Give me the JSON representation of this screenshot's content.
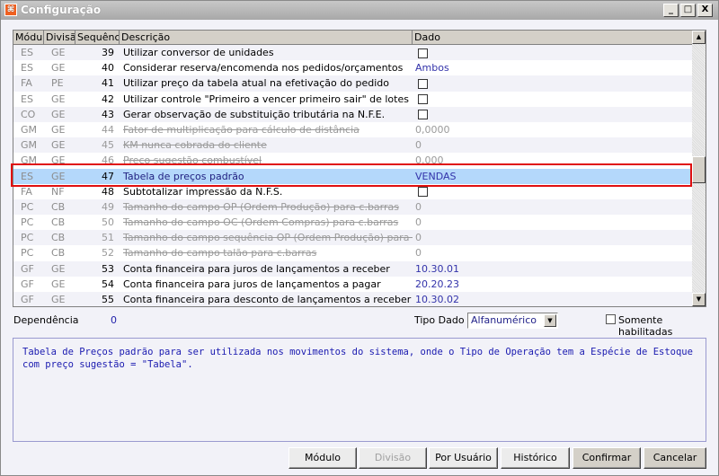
{
  "window": {
    "title": "Configuração",
    "minimize": "_",
    "maximize": "□",
    "close": "X"
  },
  "grid": {
    "headers": [
      "Módulo",
      "Divisão",
      "Sequência",
      "Descrição",
      "Dado"
    ],
    "rows": [
      {
        "modulo": "ES",
        "divisao": "GE",
        "seq": "39",
        "desc": "Utilizar conversor de unidades",
        "dado": "",
        "checkbox": true,
        "disabled": false
      },
      {
        "modulo": "ES",
        "divisao": "GE",
        "seq": "40",
        "desc": "Considerar reserva/encomenda nos pedidos/orçamentos",
        "dado": "Ambos",
        "checkbox": false,
        "disabled": false
      },
      {
        "modulo": "FA",
        "divisao": "PE",
        "seq": "41",
        "desc": "Utilizar preço da tabela atual na efetivação do pedido",
        "dado": "",
        "checkbox": true,
        "disabled": false
      },
      {
        "modulo": "ES",
        "divisao": "GE",
        "seq": "42",
        "desc": "Utilizar controle \"Primeiro a vencer primeiro sair\" de lotes",
        "dado": "",
        "checkbox": true,
        "disabled": false
      },
      {
        "modulo": "CO",
        "divisao": "GE",
        "seq": "43",
        "desc": "Gerar observação de substituição tributária na N.F.E.",
        "dado": "",
        "checkbox": true,
        "disabled": false
      },
      {
        "modulo": "GM",
        "divisao": "GE",
        "seq": "44",
        "desc": "Fator de multiplicação para cálculo de distância",
        "dado": "0,0000",
        "checkbox": false,
        "disabled": true
      },
      {
        "modulo": "GM",
        "divisao": "GE",
        "seq": "45",
        "desc": "KM nunca cobrada do cliente",
        "dado": "0",
        "checkbox": false,
        "disabled": true
      },
      {
        "modulo": "GM",
        "divisao": "GE",
        "seq": "46",
        "desc": "Preço sugestão combustível",
        "dado": "0,000",
        "checkbox": false,
        "disabled": true
      },
      {
        "modulo": "ES",
        "divisao": "GE",
        "seq": "47",
        "desc": "Tabela de preços padrão",
        "dado": "VENDAS",
        "checkbox": false,
        "disabled": false,
        "selected": true
      },
      {
        "modulo": "FA",
        "divisao": "NF",
        "seq": "48",
        "desc": "Subtotalizar impressão da N.F.S.",
        "dado": "",
        "checkbox": true,
        "disabled": false
      },
      {
        "modulo": "PC",
        "divisao": "CB",
        "seq": "49",
        "desc": "Tamanho do campo OP (Ordem Produção) para c.barras",
        "dado": "0",
        "checkbox": false,
        "disabled": true
      },
      {
        "modulo": "PC",
        "divisao": "CB",
        "seq": "50",
        "desc": "Tamanho do campo OC (Ordem Compras) para c.barras",
        "dado": "0",
        "checkbox": false,
        "disabled": true
      },
      {
        "modulo": "PC",
        "divisao": "CB",
        "seq": "51",
        "desc": "Tamanho do campo sequência OP (Ordem Produção) para c.barras",
        "dado": "0",
        "checkbox": false,
        "disabled": true
      },
      {
        "modulo": "PC",
        "divisao": "CB",
        "seq": "52",
        "desc": "Tamanho do campo talão para c.barras",
        "dado": "0",
        "checkbox": false,
        "disabled": true
      },
      {
        "modulo": "GF",
        "divisao": "GE",
        "seq": "53",
        "desc": "Conta financeira para juros de lançamentos a receber",
        "dado": "10.30.01",
        "checkbox": false,
        "disabled": false
      },
      {
        "modulo": "GF",
        "divisao": "GE",
        "seq": "54",
        "desc": "Conta financeira para juros de lançamentos a pagar",
        "dado": "20.20.23",
        "checkbox": false,
        "disabled": false
      },
      {
        "modulo": "GF",
        "divisao": "GE",
        "seq": "55",
        "desc": "Conta financeira para desconto de lançamentos a receber",
        "dado": "10.30.02",
        "checkbox": false,
        "disabled": false
      }
    ]
  },
  "footer": {
    "dependencia_label": "Dependência",
    "dependencia_value": "0",
    "tipo_dado_label": "Tipo Dado",
    "tipo_dado_value": "Alfanumérico",
    "somente_label": "Somente habilitadas"
  },
  "description": "Tabela de Preços padrão para ser utilizada nos movimentos do sistema, onde o Tipo de Operação tem a Espécie de Estoque com preço sugestão = \"Tabela\".",
  "buttons": {
    "modulo": "Módulo",
    "divisao": "Divisão",
    "por_usuario": "Por Usuário",
    "historico": "Histórico",
    "confirmar": "Confirmar",
    "cancelar": "Cancelar"
  }
}
